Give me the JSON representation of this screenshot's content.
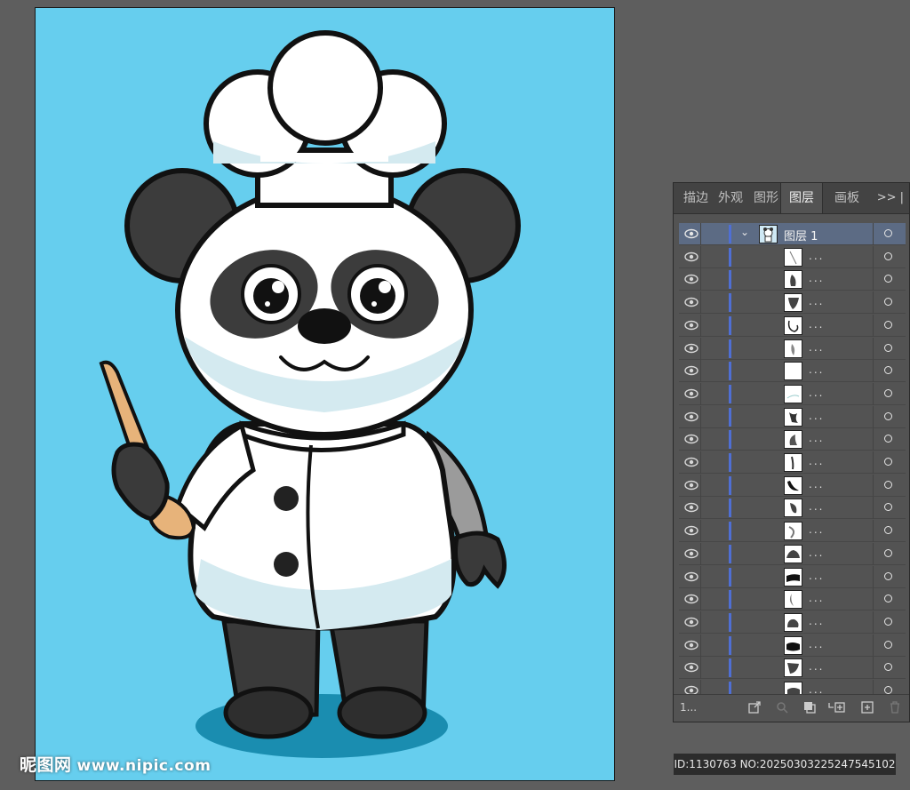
{
  "artboard": {
    "background": "#66ceee"
  },
  "watermark": {
    "brand": "昵图网",
    "url": "www.nipic.com"
  },
  "id_bar": {
    "text": "ID:1130763 NO:20250303225247545102"
  },
  "layers_panel": {
    "tabs": [
      {
        "label": "描边",
        "active": false
      },
      {
        "label": "外观",
        "active": false
      },
      {
        "label": "图形",
        "active": false
      },
      {
        "label": "图层",
        "active": true
      },
      {
        "label": "画板",
        "active": false
      }
    ],
    "more_label": ">> |",
    "parent_layer": {
      "name": "图层 1",
      "expanded": true,
      "color": "#4f6fd4"
    },
    "sublayers": [
      {
        "name": "...",
        "thumb": "stroke-line"
      },
      {
        "name": "...",
        "thumb": "dark-blob"
      },
      {
        "name": "...",
        "thumb": "dark-shape"
      },
      {
        "name": "...",
        "thumb": "outline-curve"
      },
      {
        "name": "...",
        "thumb": "grey-blob"
      },
      {
        "name": "...",
        "thumb": "white-blank"
      },
      {
        "name": "...",
        "thumb": "light-curve"
      },
      {
        "name": "...",
        "thumb": "dark-hook"
      },
      {
        "name": "...",
        "thumb": "dark-leaf"
      },
      {
        "name": "...",
        "thumb": "dark-line"
      },
      {
        "name": "...",
        "thumb": "black-crescent"
      },
      {
        "name": "...",
        "thumb": "dark-drop"
      },
      {
        "name": "...",
        "thumb": "grey-arc"
      },
      {
        "name": "...",
        "thumb": "dark-mound"
      },
      {
        "name": "...",
        "thumb": "black-band"
      },
      {
        "name": "...",
        "thumb": "grey-moon"
      },
      {
        "name": "...",
        "thumb": "dark-lump"
      },
      {
        "name": "...",
        "thumb": "black-wave"
      },
      {
        "name": "...",
        "thumb": "dark-corner"
      },
      {
        "name": "...",
        "thumb": "dark-partial"
      }
    ],
    "footer": {
      "count_label": "1...",
      "icons": [
        "export-icon",
        "search-icon",
        "clip-mask-icon",
        "new-sublayer-icon",
        "new-layer-icon",
        "trash-icon"
      ]
    }
  }
}
